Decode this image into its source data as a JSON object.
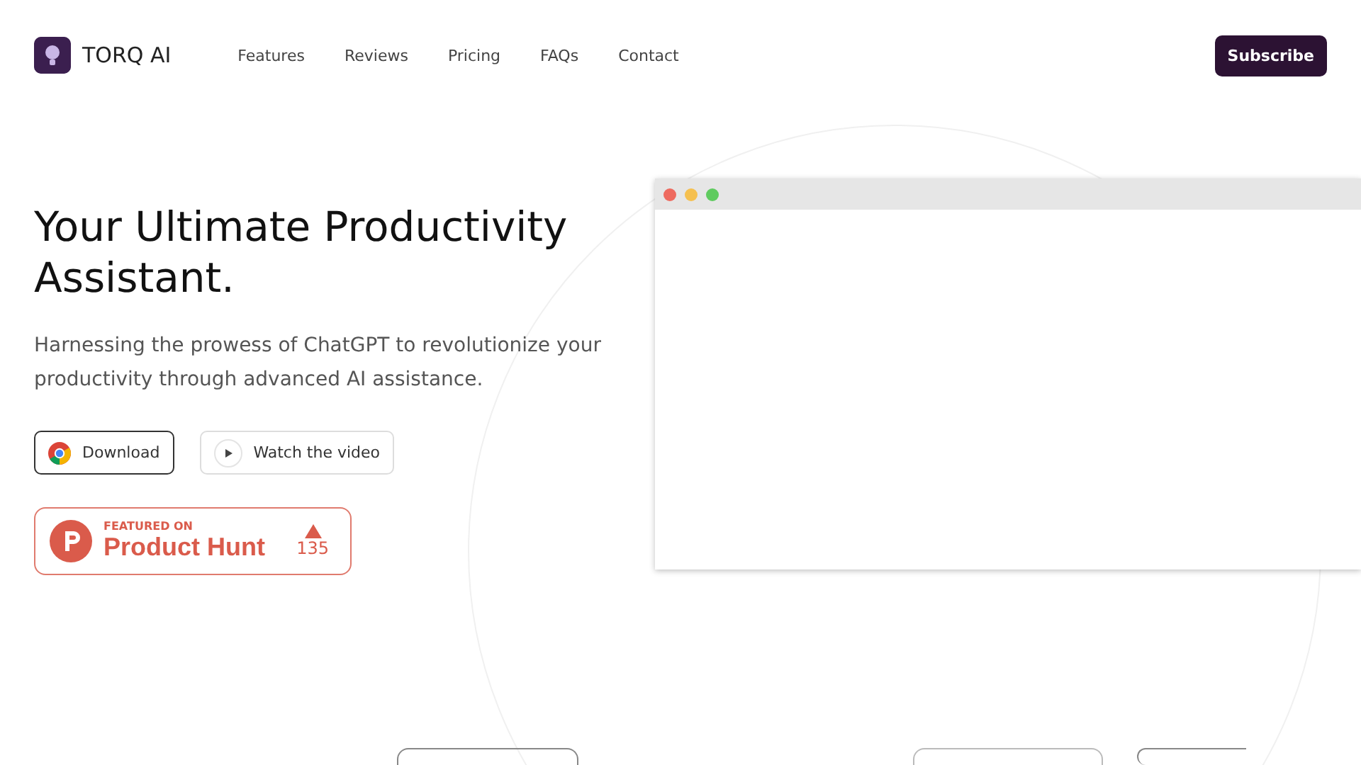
{
  "brand": {
    "name": "TORQ AI"
  },
  "nav": [
    {
      "label": "Features"
    },
    {
      "label": "Reviews"
    },
    {
      "label": "Pricing"
    },
    {
      "label": "FAQs"
    },
    {
      "label": "Contact"
    }
  ],
  "subscribe": "Subscribe",
  "hero": {
    "title": "Your Ultimate Productivity Assistant.",
    "subtitle": "Harnessing the prowess of ChatGPT to revolutionize your productivity through advanced AI assistance.",
    "buttons": [
      {
        "kind": "download",
        "label": "Download"
      },
      {
        "kind": "video",
        "label": "Watch the video"
      }
    ],
    "badge": {
      "kicker": "FEATURED ON",
      "name": "Product Hunt",
      "votes": "135"
    }
  },
  "window_controls": [
    {
      "color": "#ee6a5f"
    },
    {
      "color": "#f5c04f"
    },
    {
      "color": "#5fcb5f"
    }
  ]
}
